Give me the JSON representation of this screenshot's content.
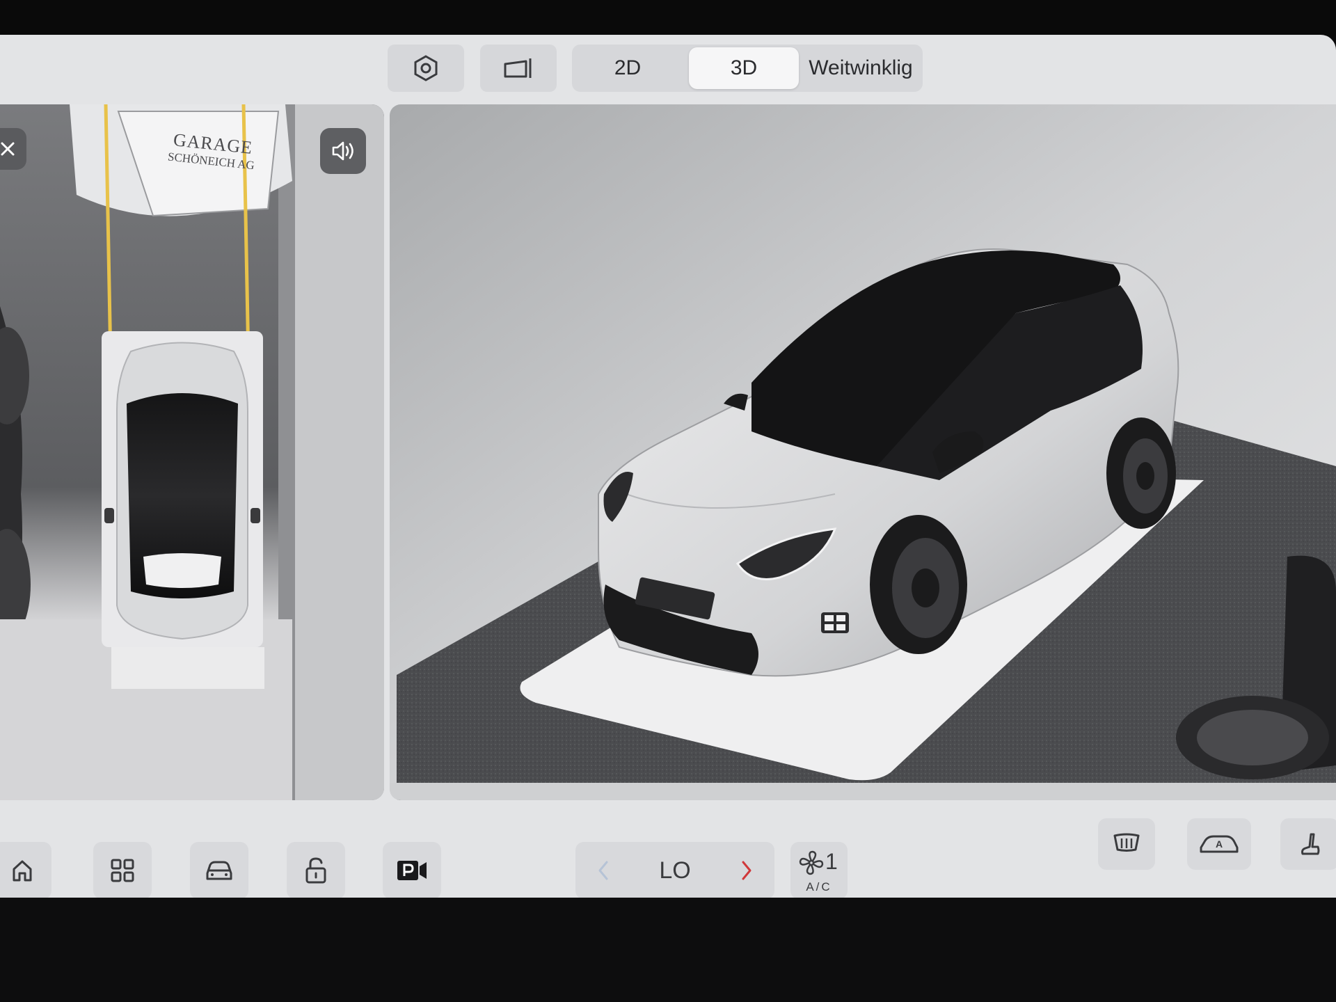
{
  "toolbar": {
    "settings_icon": "gear-hexagon-icon",
    "view_toggle_icon": "camera-view-icon",
    "view_modes": [
      "2D",
      "3D",
      "Weitwinklig"
    ],
    "active_mode": "3D"
  },
  "left_camera": {
    "garage_sign_line1": "GARAGE",
    "garage_sign_line2": "SCHÖNEICH AG",
    "close_icon": "close-icon",
    "sound_icon": "volume-icon",
    "guide_line_color": "#e8c24a"
  },
  "dock": {
    "home_icon": "home-icon",
    "apps_icon": "apps-grid-icon",
    "car_icon": "car-icon",
    "lock_icon": "unlock-icon",
    "parking_camera_icon": "parking-camera-icon",
    "temperature": "LO",
    "prev_icon": "chevron-left-icon",
    "next_icon": "chevron-right-icon",
    "fan_speed": "1",
    "ac_label": "A/C",
    "defrost_icon": "rear-defrost-icon",
    "auto_icon": "auto-climate-icon",
    "seat_icon": "seat-heat-icon",
    "accent_red": "#d0383a"
  }
}
